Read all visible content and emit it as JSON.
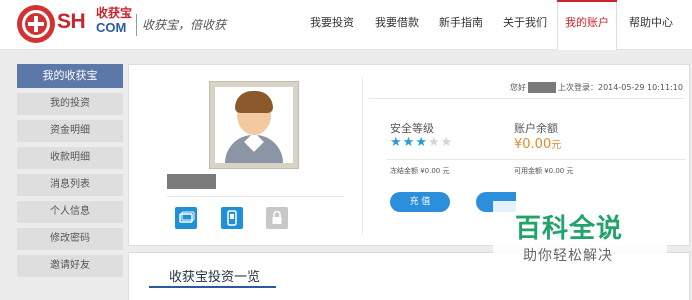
{
  "header": {
    "logo_sh": "SH",
    "logo_cn": "收获宝",
    "logo_com": "COM",
    "slogan": "收获宝，倍收获",
    "nav": [
      {
        "label": "我要投资"
      },
      {
        "label": "我要借款"
      },
      {
        "label": "新手指南"
      },
      {
        "label": "关于我们"
      },
      {
        "label": "我的账户",
        "active": true
      },
      {
        "label": "帮助中心"
      }
    ]
  },
  "sidebar": {
    "title": "我的收获宝",
    "items": [
      {
        "label": "我的投资"
      },
      {
        "label": "资金明细"
      },
      {
        "label": "收款明细"
      },
      {
        "label": "消息列表"
      },
      {
        "label": "个人信息"
      },
      {
        "label": "修改密码"
      },
      {
        "label": "邀请好友"
      }
    ]
  },
  "account": {
    "greeting_prefix": "您好",
    "last_login": "上次登录：2014-05-29 10:11:10",
    "security_label": "安全等级",
    "security_stars": 3,
    "security_stars_total": 5,
    "balance_label": "账户余额",
    "balance_symbol": "¥",
    "balance_value": "0.00",
    "balance_unit": "元",
    "frozen": "冻结金额 ¥0.00 元",
    "available": "可用金额 ¥0.00 元",
    "recharge_label": "充 值"
  },
  "verify_icons": [
    {
      "name": "bank-card-icon",
      "state": "verified"
    },
    {
      "name": "phone-icon",
      "state": "verified"
    },
    {
      "name": "lock-icon",
      "state": "unverified"
    }
  ],
  "investments": {
    "title": "收获宝投资一览"
  },
  "watermark": {
    "title": "百科全说",
    "subtitle": "助你轻松解决"
  },
  "colors": {
    "brand_red": "#c9252c",
    "brand_blue": "#2c5aa0",
    "sidebar_title": "#5b78a8",
    "button_blue": "#2b8fdc",
    "balance_orange": "#e08a2e",
    "watermark_green": "#22a36a"
  }
}
